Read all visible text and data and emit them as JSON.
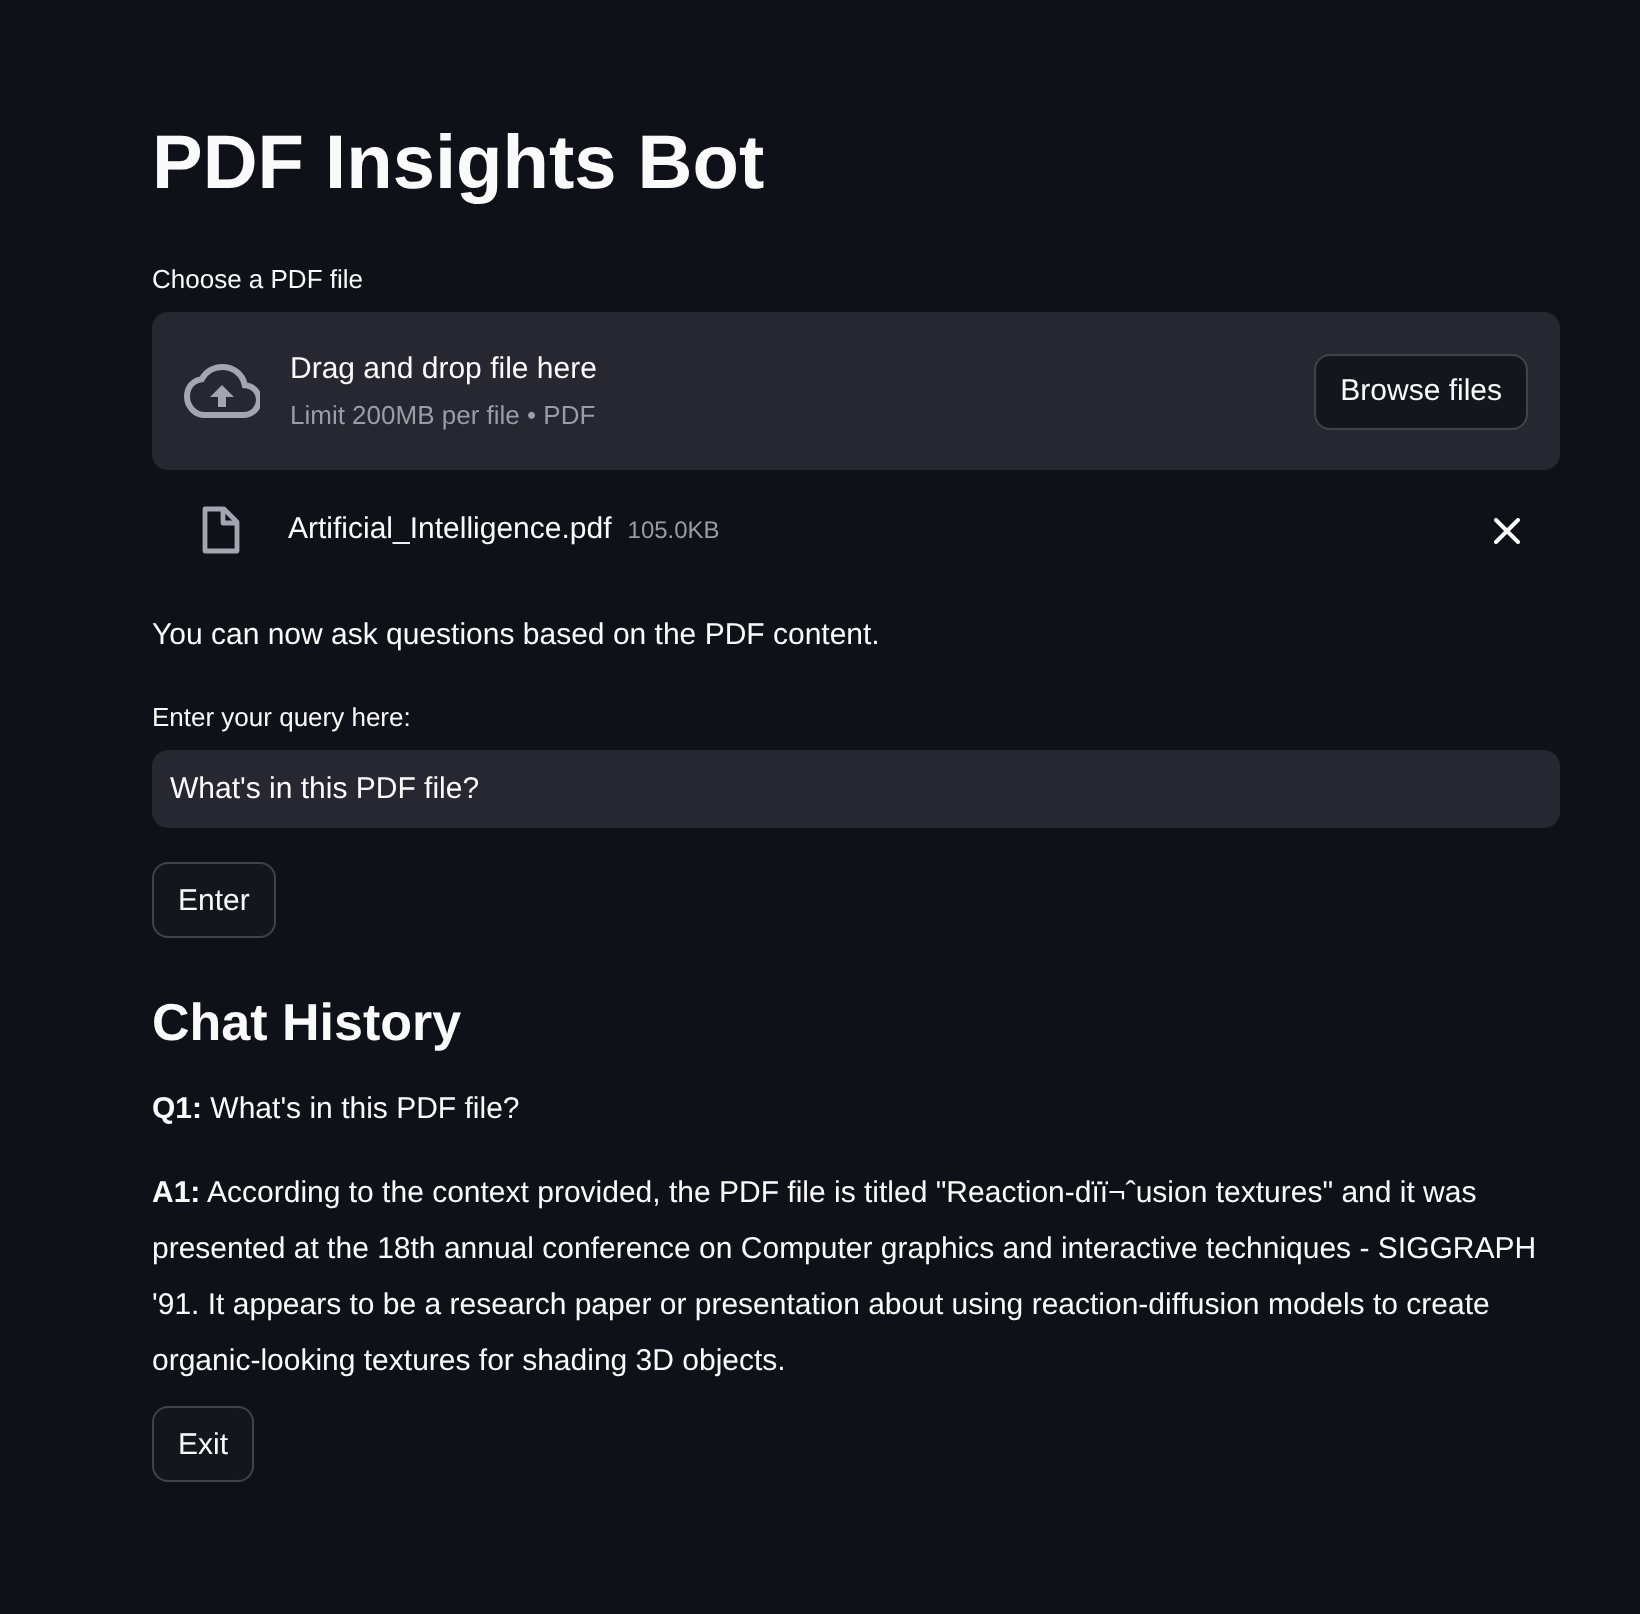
{
  "title": "PDF Insights Bot",
  "uploader": {
    "label": "Choose a PDF file",
    "instruction": "Drag and drop file here",
    "limit": "Limit 200MB per file • PDF",
    "button": "Browse files"
  },
  "uploaded_file": {
    "name": "Artificial_Intelligence.pdf",
    "size": "105.0KB"
  },
  "status_message": "You can now ask questions based on the PDF content.",
  "query": {
    "label": "Enter your query here:",
    "value": "What's in this PDF file?"
  },
  "submit_button": "Enter",
  "chat_history": {
    "heading": "Chat History",
    "messages": [
      "**Q1:** What's in this PDF file?",
      "**A1:** According to the context provided, the PDF file is titled \"Reaction-dïï¬ˆusion textures\" and it was presented at the 18th annual conference on Computer graphics and interactive techniques - SIGGRAPH '91. It appears to be a research paper or presentation about using reaction-diffusion models to create organic-looking textures for shading 3D objects."
    ]
  },
  "exit_button": "Exit"
}
